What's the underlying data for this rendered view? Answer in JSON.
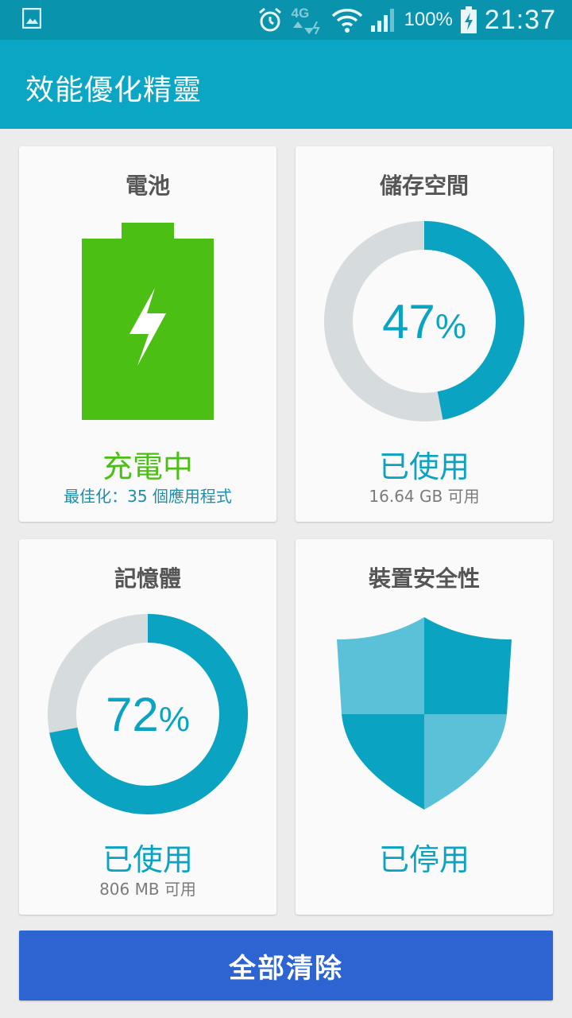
{
  "status_bar": {
    "network_label": "4G",
    "battery_percent": "100%",
    "time": "21:37",
    "icons": [
      "gallery-icon",
      "alarm-icon",
      "4g-data-icon",
      "wifi-icon",
      "signal-icon",
      "battery-charging-icon"
    ]
  },
  "app_bar": {
    "title": "效能優化精靈"
  },
  "cards": {
    "battery": {
      "title": "電池",
      "status": "充電中",
      "detail": "最佳化：35 個應用程式"
    },
    "storage": {
      "title": "儲存空間",
      "percent_value": "47",
      "percent_sign": "%",
      "used_fraction": 0.47,
      "status": "已使用",
      "detail": "16.64 GB 可用"
    },
    "memory": {
      "title": "記憶體",
      "percent_value": "72",
      "percent_sign": "%",
      "used_fraction": 0.72,
      "status": "已使用",
      "detail": "806 MB 可用"
    },
    "security": {
      "title": "裝置安全性",
      "status": "已停用"
    }
  },
  "actions": {
    "clear_all": "全部清除"
  },
  "colors": {
    "accent": "#0aa3c2",
    "charging_green": "#4cbf14",
    "button_blue": "#2e64d2",
    "ring_track": "#d6dcdd"
  }
}
